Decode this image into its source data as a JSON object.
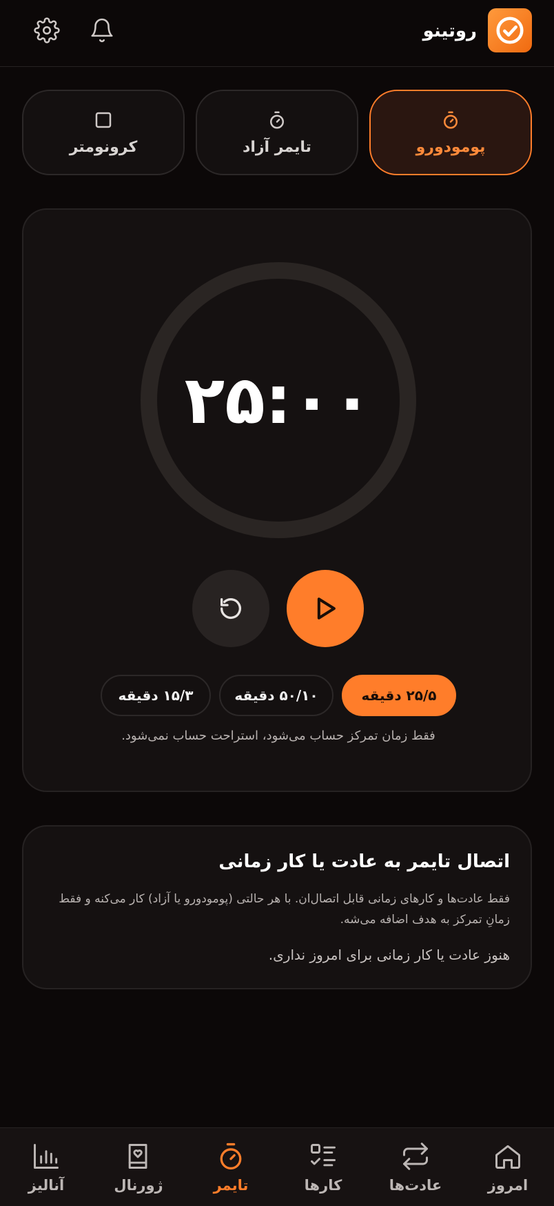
{
  "header": {
    "title": "روتینو",
    "logo_icon": "check-circle-icon",
    "settings_icon": "gear-icon",
    "notifications_icon": "bell-icon"
  },
  "modes": [
    {
      "label": "پومودورو",
      "icon": "stopwatch-icon",
      "active": true
    },
    {
      "label": "تایمر آزاد",
      "icon": "stopwatch-icon",
      "active": false
    },
    {
      "label": "کرونومتر",
      "icon": "square-icon",
      "active": false
    }
  ],
  "timer": {
    "time": "۲۵:۰۰",
    "progress": 0,
    "presets": [
      {
        "label": "۲۵/۵ دقیقه",
        "active": true
      },
      {
        "label": "۵۰/۱۰ دقیقه",
        "active": false
      },
      {
        "label": "۱۵/۳ دقیقه",
        "active": false
      }
    ],
    "note": "فقط زمان تمرکز حساب می‌شود، استراحت حساب نمی‌شود."
  },
  "link_card": {
    "title": "اتصال تایمر به عادت یا کار زمانی",
    "description": "فقط عادت‌ها و کارهای زمانی قابل اتصال‌ان. با هر حالتی (پومودورو یا آزاد) کار می‌کنه و فقط زمانِ تمرکز به هدف اضافه می‌شه.",
    "empty": "هنوز عادت یا کار زمانی برای امروز نداری."
  },
  "nav": [
    {
      "label": "امروز",
      "icon": "home-icon",
      "active": false
    },
    {
      "label": "عادت‌ها",
      "icon": "repeat-icon",
      "active": false
    },
    {
      "label": "کارها",
      "icon": "checklist-icon",
      "active": false
    },
    {
      "label": "تایمر",
      "icon": "stopwatch-icon",
      "active": true
    },
    {
      "label": "ژورنال",
      "icon": "journal-icon",
      "active": false
    },
    {
      "label": "آنالیز",
      "icon": "bar-chart-icon",
      "active": false
    }
  ],
  "colors": {
    "accent": "#ff7d2a",
    "background": "#0c0808",
    "card": "#151111"
  }
}
